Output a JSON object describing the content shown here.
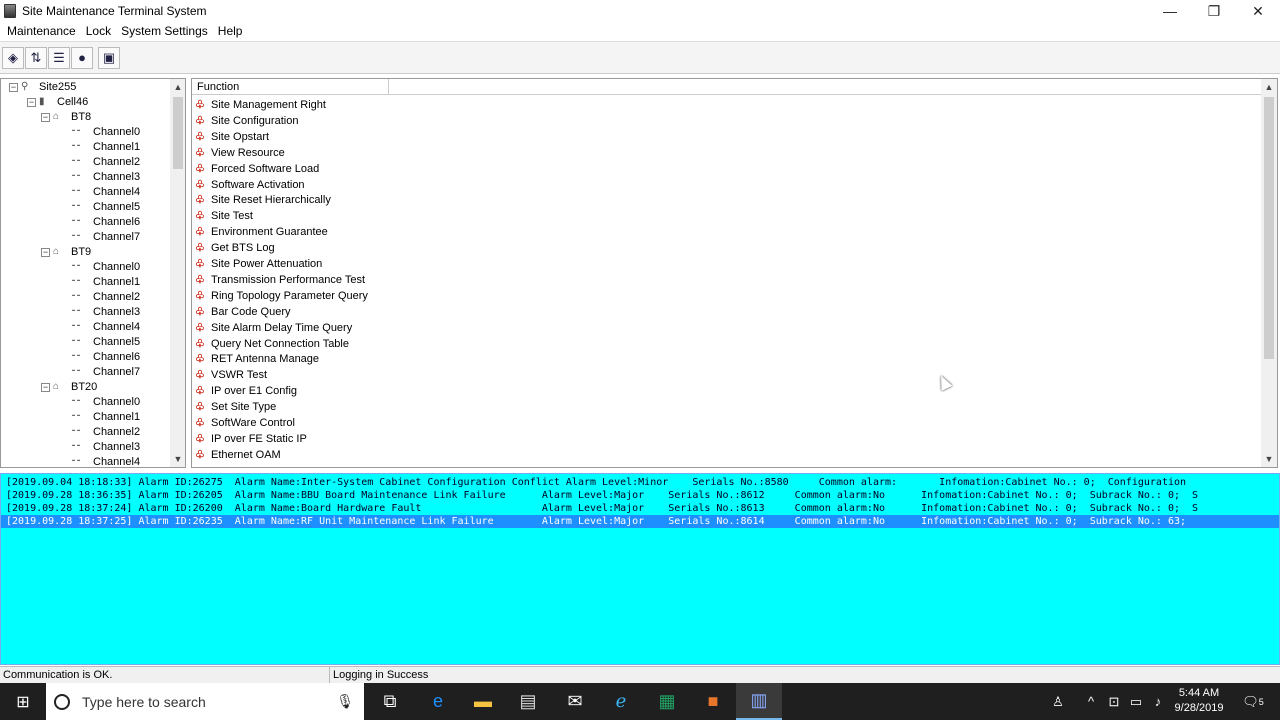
{
  "window": {
    "title": "Site Maintenance Terminal System"
  },
  "menu": [
    "Maintenance",
    "Lock",
    "System Settings",
    "Help"
  ],
  "toolbar_icons": [
    "connect-icon",
    "transfer-icon",
    "settings-icon",
    "globe-icon",
    "report-icon"
  ],
  "tree": {
    "root": "Site255",
    "cell": "Cell46",
    "groups": [
      {
        "name": "BT8",
        "channels": [
          "Channel0",
          "Channel1",
          "Channel2",
          "Channel3",
          "Channel4",
          "Channel5",
          "Channel6",
          "Channel7"
        ]
      },
      {
        "name": "BT9",
        "channels": [
          "Channel0",
          "Channel1",
          "Channel2",
          "Channel3",
          "Channel4",
          "Channel5",
          "Channel6",
          "Channel7"
        ]
      },
      {
        "name": "BT20",
        "channels": [
          "Channel0",
          "Channel1",
          "Channel2",
          "Channel3",
          "Channel4"
        ]
      }
    ]
  },
  "functions": {
    "column": "Function",
    "items": [
      "Site Management Right",
      "Site Configuration",
      "Site Opstart",
      "View Resource",
      "Forced Software Load",
      "Software Activation",
      "Site Reset Hierarchically",
      "Site Test",
      "Environment Guarantee",
      "Get BTS Log",
      "Site Power Attenuation",
      "Transmission Performance Test",
      "Ring Topology Parameter Query",
      "Bar Code Query",
      "Site Alarm Delay Time Query",
      "Query Net Connection Table",
      "RET Antenna Manage",
      "VSWR Test",
      "IP over E1 Config",
      "Set Site Type",
      "SoftWare Control",
      "IP over FE Static IP",
      "Ethernet OAM"
    ]
  },
  "alarms": [
    "[2019.09.04 18:18:33] Alarm ID:26275  Alarm Name:Inter-System Cabinet Configuration Conflict Alarm Level:Minor    Serials No.:8580     Common alarm:       Infomation:Cabinet No.: 0;  Configuration",
    "[2019.09.28 18:36:35] Alarm ID:26205  Alarm Name:BBU Board Maintenance Link Failure      Alarm Level:Major    Serials No.:8612     Common alarm:No      Infomation:Cabinet No.: 0;  Subrack No.: 0;  S",
    "[2019.09.28 18:37:24] Alarm ID:26200  Alarm Name:Board Hardware Fault                    Alarm Level:Major    Serials No.:8613     Common alarm:No      Infomation:Cabinet No.: 0;  Subrack No.: 0;  S",
    "[2019.09.28 18:37:25] Alarm ID:26235  Alarm Name:RF Unit Maintenance Link Failure        Alarm Level:Major    Serials No.:8614     Common alarm:No      Infomation:Cabinet No.: 0;  Subrack No.: 63;  "
  ],
  "status": {
    "left": "Communication is OK.",
    "right": "Logging in Success"
  },
  "taskbar": {
    "search_placeholder": "Type here to search",
    "time": "5:44 AM",
    "date": "9/28/2019",
    "notifications": "5"
  },
  "colors": {
    "alarm_bg": "#00ffff",
    "selected_row": "#1e8fff"
  }
}
